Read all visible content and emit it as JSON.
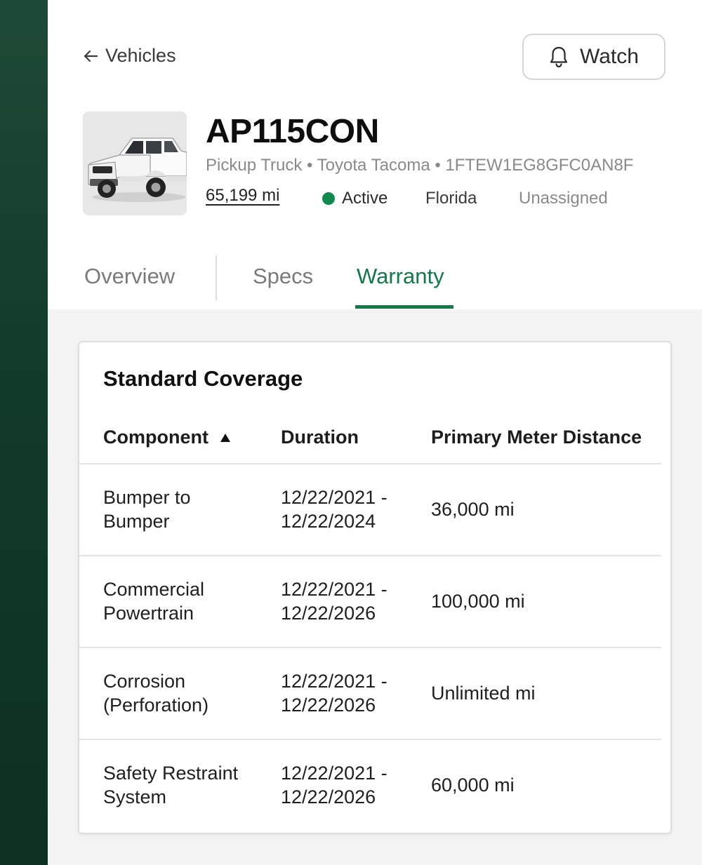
{
  "nav": {
    "back_label": "Vehicles",
    "watch_label": "Watch"
  },
  "vehicle": {
    "id": "AP115CON",
    "type": "Pickup Truck",
    "model": "Toyota Tacoma",
    "vin": "1FTEW1EG8GFC0AN8F",
    "subtitle": "Pickup Truck • Toyota Tacoma • 1FTEW1EG8GFC0AN8F",
    "mileage": "65,199 mi",
    "status": "Active",
    "status_color": "#0f8a4c",
    "location": "Florida",
    "assignee": "Unassigned"
  },
  "tabs": [
    {
      "label": "Overview",
      "active": false
    },
    {
      "label": "Specs",
      "active": false
    },
    {
      "label": "Warranty",
      "active": true
    }
  ],
  "accent_color": "#14794a",
  "warranty": {
    "title": "Standard Coverage",
    "columns": [
      "Component",
      "Duration",
      "Primary Meter Distance"
    ],
    "sort": {
      "column": "Component",
      "direction": "ascending"
    },
    "rows": [
      {
        "component_1": "Bumper to",
        "component_2": "Bumper",
        "start": "12/22/2021 -",
        "end": "12/22/2024",
        "distance": "36,000 mi"
      },
      {
        "component_1": "Commercial",
        "component_2": "Powertrain",
        "start": "12/22/2021 -",
        "end": "12/22/2026",
        "distance": "100,000 mi"
      },
      {
        "component_1": "Corrosion",
        "component_2": "(Perforation)",
        "start": "12/22/2021 -",
        "end": "12/22/2026",
        "distance": "Unlimited mi"
      },
      {
        "component_1": "Safety Restraint",
        "component_2": "System",
        "start": "12/22/2021 -",
        "end": "12/22/2026",
        "distance": "60,000 mi"
      }
    ]
  }
}
